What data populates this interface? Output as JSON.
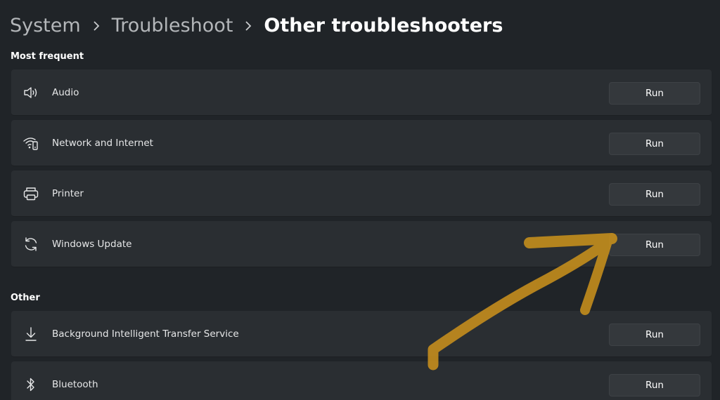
{
  "breadcrumb": {
    "system": "System",
    "troubleshoot": "Troubleshoot",
    "current": "Other troubleshooters"
  },
  "sections": {
    "most_frequent": "Most frequent",
    "other": "Other"
  },
  "items": [
    {
      "label": "Audio",
      "icon": "speaker-icon",
      "button": "Run"
    },
    {
      "label": "Network and Internet",
      "icon": "network-icon",
      "button": "Run"
    },
    {
      "label": "Printer",
      "icon": "printer-icon",
      "button": "Run"
    },
    {
      "label": "Windows Update",
      "icon": "sync-icon",
      "button": "Run"
    },
    {
      "label": "Background Intelligent Transfer Service",
      "icon": "download-icon",
      "button": "Run"
    },
    {
      "label": "Bluetooth",
      "icon": "bluetooth-icon",
      "button": "Run"
    }
  ],
  "colors": {
    "background": "#202428",
    "card": "#2a2e32",
    "button": "#34383c",
    "annotation_arrow": "#c8901c"
  }
}
